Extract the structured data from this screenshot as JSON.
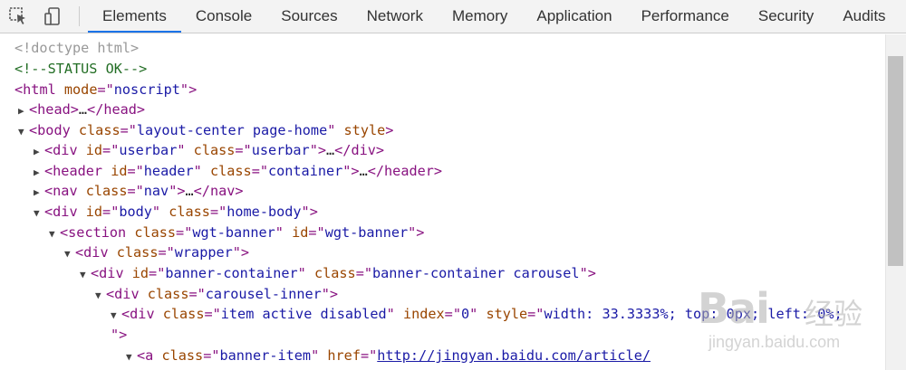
{
  "toolbar": {
    "inspect_icon": "inspect-element-icon",
    "device_icon": "device-toolbar-icon",
    "tabs": [
      "Elements",
      "Console",
      "Sources",
      "Network",
      "Memory",
      "Application",
      "Performance",
      "Security",
      "Audits"
    ],
    "active_tab": "Elements"
  },
  "dom": {
    "l1": "<!doctype html>",
    "l2": "<!--STATUS OK-->",
    "l3": {
      "tag": "html",
      "attr": "mode",
      "val": "noscript"
    },
    "l4": {
      "tag": "head",
      "ellipsis": "…"
    },
    "l5": {
      "tag": "body",
      "attr1": "class",
      "val1": "layout-center page-home",
      "attr2": "style"
    },
    "l6": {
      "tag": "div",
      "attr1": "id",
      "val1": "userbar",
      "attr2": "class",
      "val2": "userbar",
      "ellipsis": "…"
    },
    "l7": {
      "tag": "header",
      "attr1": "id",
      "val1": "header",
      "attr2": "class",
      "val2": "container",
      "ellipsis": "…"
    },
    "l8": {
      "tag": "nav",
      "attr1": "class",
      "val1": "nav",
      "ellipsis": "…"
    },
    "l9": {
      "tag": "div",
      "attr1": "id",
      "val1": "body",
      "attr2": "class",
      "val2": "home-body"
    },
    "l10": {
      "tag": "section",
      "attr1": "class",
      "val1": "wgt-banner",
      "attr2": "id",
      "val2": "wgt-banner"
    },
    "l11": {
      "tag": "div",
      "attr1": "class",
      "val1": "wrapper"
    },
    "l12": {
      "tag": "div",
      "attr1": "id",
      "val1": "banner-container",
      "attr2": "class",
      "val2": "banner-container carousel"
    },
    "l13": {
      "tag": "div",
      "attr1": "class",
      "val1": "carousel-inner"
    },
    "l14": {
      "tag": "div",
      "attr1": "class",
      "val1": "item active disabled",
      "attr2": "index",
      "val2": "0",
      "attr3": "style",
      "val3": "width: 33.3333%; top: 0px; left: 0%;"
    },
    "l15": "\">",
    "l16": {
      "tag": "a",
      "attr1": "class",
      "val1": "banner-item",
      "attr2": "href",
      "val2": "http://jingyan.baidu.com/article/"
    }
  },
  "watermark": {
    "brand": "Bai",
    "brand_text": "经验",
    "url": "jingyan.baidu.com"
  }
}
